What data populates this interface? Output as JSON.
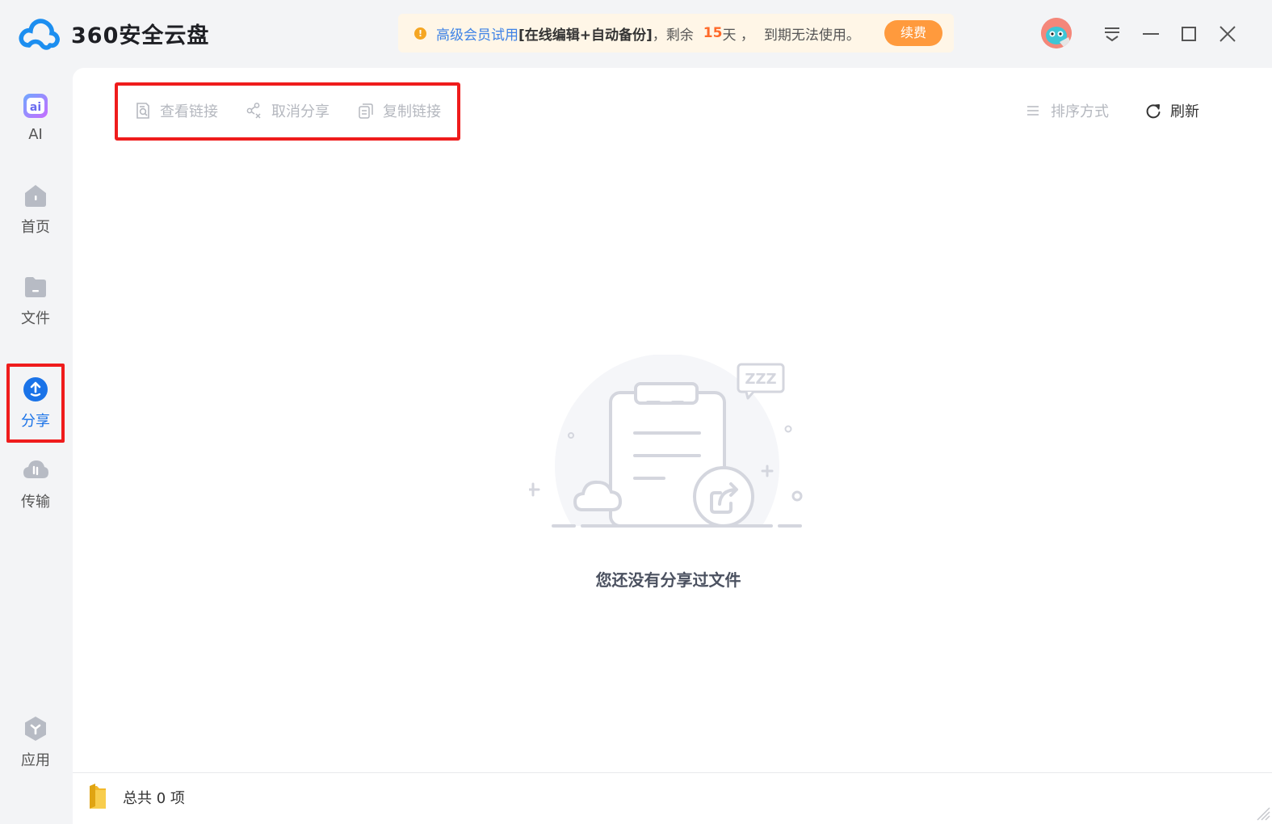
{
  "app": {
    "title": "360安全云盘"
  },
  "notice": {
    "text_trial": "高级会员试用",
    "text_features": "[在线编辑+自动备份]",
    "text_remaining": "，剩余",
    "days": "15",
    "text_days_unit": "天 ，",
    "text_expire": "到期无法使用。",
    "renew_label": "续费"
  },
  "sidebar": {
    "items": [
      {
        "label": "AI",
        "icon": "ai-icon"
      },
      {
        "label": "首页",
        "icon": "home-icon"
      },
      {
        "label": "文件",
        "icon": "folder-icon"
      },
      {
        "label": "分享",
        "icon": "share-icon"
      },
      {
        "label": "传输",
        "icon": "transfer-icon"
      },
      {
        "label": "应用",
        "icon": "apps-icon"
      }
    ],
    "active": "分享"
  },
  "toolbar": {
    "view_link": "查看链接",
    "cancel_share": "取消分享",
    "copy_link": "复制链接",
    "sort": "排序方式",
    "refresh": "刷新"
  },
  "empty": {
    "message": "您还没有分享过文件",
    "illustration_text": "ZZZ"
  },
  "footer": {
    "count": "总共 0 项"
  },
  "colors": {
    "accent": "#1a73e8",
    "highlight": "#ef1c1c",
    "renew": "#ff9a3d",
    "disabled": "#b5b8bf"
  }
}
